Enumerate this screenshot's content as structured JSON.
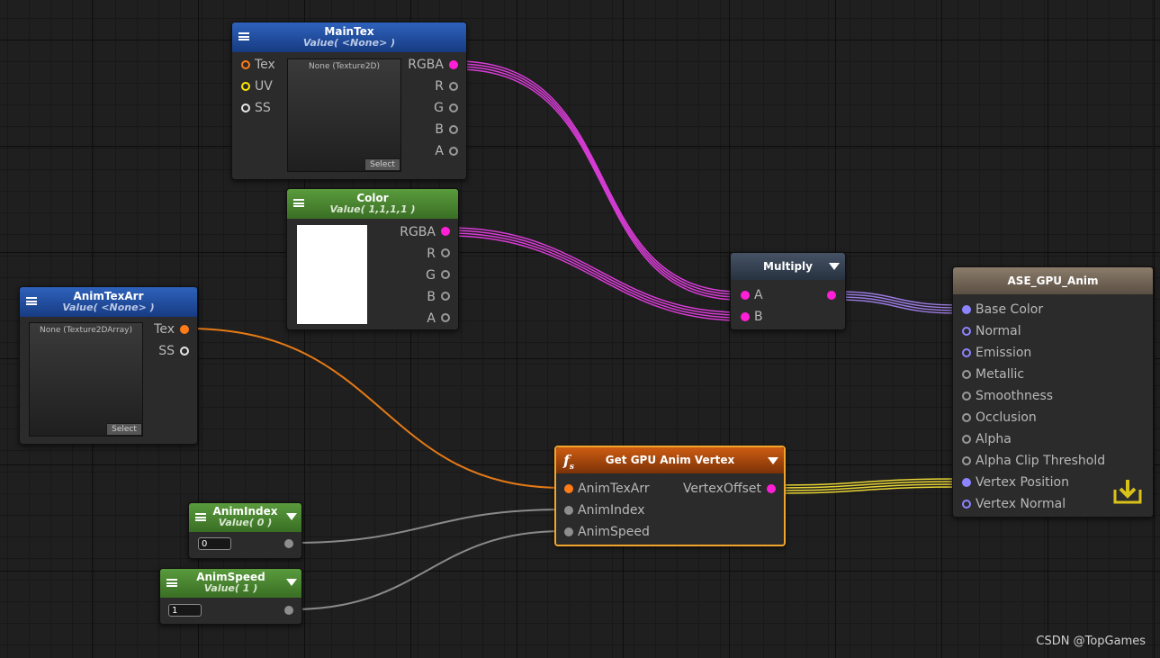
{
  "nodes": {
    "maintex": {
      "title": "MainTex",
      "subtitle": "Value( <None> )",
      "preview_text": "None (Texture2D)",
      "select_label": "Select",
      "inputs": [
        "Tex",
        "UV",
        "SS"
      ],
      "outputs": [
        "RGBA",
        "R",
        "G",
        "B",
        "A"
      ]
    },
    "color": {
      "title": "Color",
      "subtitle": "Value( 1,1,1,1 )",
      "swatch_color": "#ffffff",
      "outputs": [
        "RGBA",
        "R",
        "G",
        "B",
        "A"
      ]
    },
    "animtexarr": {
      "title": "AnimTexArr",
      "subtitle": "Value( <None> )",
      "preview_text": "None (Texture2DArray)",
      "select_label": "Select",
      "outputs": [
        "Tex",
        "SS"
      ]
    },
    "multiply": {
      "title": "Multiply",
      "inputs": [
        "A",
        "B"
      ]
    },
    "animindex": {
      "title": "AnimIndex",
      "subtitle": "Value( 0 )",
      "value": "0"
    },
    "animspeed": {
      "title": "AnimSpeed",
      "subtitle": "Value( 1 )",
      "value": "1"
    },
    "getgpu": {
      "title": "Get GPU Anim Vertex",
      "inputs": [
        "AnimTexArr",
        "AnimIndex",
        "AnimSpeed"
      ],
      "outputs": [
        "VertexOffset"
      ]
    },
    "output": {
      "title": "ASE_GPU_Anim",
      "inputs": [
        "Base Color",
        "Normal",
        "Emission",
        "Metallic",
        "Smoothness",
        "Occlusion",
        "Alpha",
        "Alpha Clip Threshold",
        "Vertex Position",
        "Vertex Normal"
      ]
    }
  },
  "colors": {
    "wire_color": "#d83cd6",
    "wire_tex": "#e57a16",
    "wire_float": "#8a8a8a",
    "wire_vec": "#e8d535",
    "wire_out": "#9a7be0",
    "canvas": "#1f1f1f"
  },
  "watermark": "CSDN @TopGames"
}
